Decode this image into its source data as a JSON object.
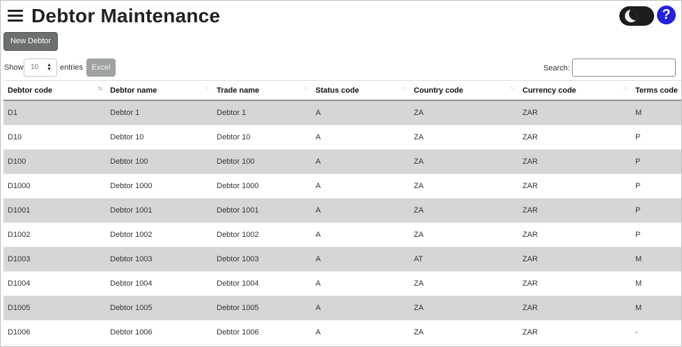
{
  "header": {
    "title": "Debtor Maintenance"
  },
  "help": {
    "label": "?"
  },
  "toolbar": {
    "new_label": "New Debtor",
    "excel_label": "Excel"
  },
  "length": {
    "show_label": "Show",
    "value": "10",
    "entries_label": "entries"
  },
  "search": {
    "label": "Search:",
    "value": ""
  },
  "table": {
    "columns": [
      "Debtor code",
      "Debtor name",
      "Trade name",
      "Status code",
      "Country code",
      "Currency code",
      "Terms code"
    ],
    "rows": [
      [
        "D1",
        "Debtor 1",
        "Debtor 1",
        "A",
        "ZA",
        "ZAR",
        "M"
      ],
      [
        "D10",
        "Debtor 10",
        "Debtor 10",
        "A",
        "ZA",
        "ZAR",
        "P"
      ],
      [
        "D100",
        "Debtor 100",
        "Debtor 100",
        "A",
        "ZA",
        "ZAR",
        "P"
      ],
      [
        "D1000",
        "Debtor 1000",
        "Debtor 1000",
        "A",
        "ZA",
        "ZAR",
        "P"
      ],
      [
        "D1001",
        "Debtor 1001",
        "Debtor 1001",
        "A",
        "ZA",
        "ZAR",
        "P"
      ],
      [
        "D1002",
        "Debtor 1002",
        "Debtor 1002",
        "A",
        "ZA",
        "ZAR",
        "P"
      ],
      [
        "D1003",
        "Debtor 1003",
        "Debtor 1003",
        "A",
        "AT",
        "ZAR",
        "M"
      ],
      [
        "D1004",
        "Debtor 1004",
        "Debtor 1004",
        "A",
        "ZA",
        "ZAR",
        "M"
      ],
      [
        "D1005",
        "Debtor 1005",
        "Debtor 1005",
        "A",
        "ZA",
        "ZAR",
        "M"
      ],
      [
        "D1006",
        "Debtor 1006",
        "Debtor 1006",
        "A",
        "ZA",
        "ZAR",
        "-"
      ]
    ]
  }
}
